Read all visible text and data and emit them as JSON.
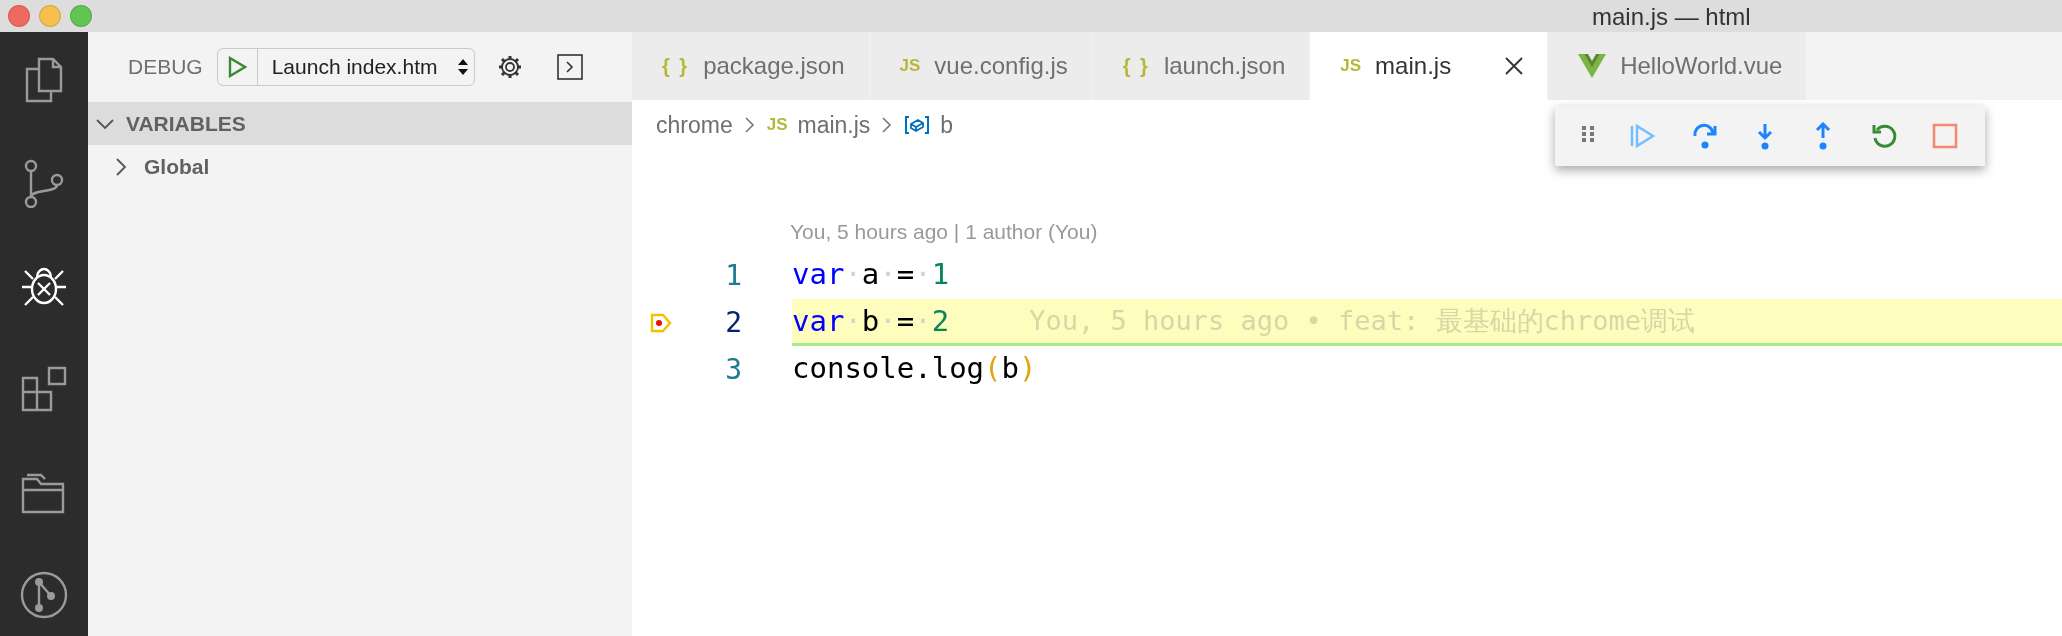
{
  "window": {
    "title": "main.js — html"
  },
  "activity_bar": [
    {
      "kind": "files",
      "selected": false
    },
    {
      "kind": "scm",
      "selected": false
    },
    {
      "kind": "debug",
      "selected": true
    },
    {
      "kind": "extensions",
      "selected": false
    },
    {
      "kind": "folders",
      "selected": false
    },
    {
      "kind": "git",
      "selected": false
    }
  ],
  "sidebar": {
    "debug_label": "DEBUG",
    "launch_config": "Launch index.htm",
    "sections": [
      {
        "title": "VARIABLES",
        "expanded": true,
        "items": [
          {
            "label": "Global",
            "expanded": false
          }
        ]
      }
    ]
  },
  "tabs": [
    {
      "kind": "json",
      "icon_text": "{ }",
      "label": "package.json",
      "selected": false
    },
    {
      "kind": "js",
      "icon_text": "JS",
      "label": "vue.config.js",
      "selected": false
    },
    {
      "kind": "json",
      "icon_text": "{ }",
      "label": "launch.json",
      "selected": false
    },
    {
      "kind": "js",
      "icon_text": "JS",
      "label": "main.js",
      "selected": true
    },
    {
      "kind": "vue",
      "label": "HelloWorld.vue",
      "selected": false
    }
  ],
  "breadcrumbs": [
    {
      "kind": "folder",
      "label": "chrome"
    },
    {
      "kind": "js",
      "icon_text": "JS",
      "label": "main.js"
    },
    {
      "kind": "symbol",
      "label": "b"
    }
  ],
  "editor": {
    "blame_header": "You, 5 hours ago | 1 author (You)",
    "lines": [
      {
        "number": "1",
        "paused": false,
        "tokens": [
          {
            "kind": "keyword",
            "text": "var"
          },
          {
            "kind": "space",
            "text": "·"
          },
          {
            "kind": "plain",
            "text": "a"
          },
          {
            "kind": "space",
            "text": "·"
          },
          {
            "kind": "plain",
            "text": "="
          },
          {
            "kind": "space",
            "text": "·"
          },
          {
            "kind": "number",
            "text": "1"
          }
        ]
      },
      {
        "number": "2",
        "paused": true,
        "blame": "You, 5 hours ago • feat: 最基础的chrome调试",
        "tokens": [
          {
            "kind": "keyword",
            "text": "var"
          },
          {
            "kind": "space",
            "text": "·"
          },
          {
            "kind": "plain",
            "text": "b"
          },
          {
            "kind": "space",
            "text": "·"
          },
          {
            "kind": "plain",
            "text": "="
          },
          {
            "kind": "space",
            "text": "·"
          },
          {
            "kind": "number",
            "text": "2"
          }
        ]
      },
      {
        "number": "3",
        "paused": false,
        "tokens": [
          {
            "kind": "plain",
            "text": "console.log"
          },
          {
            "kind": "paren",
            "text": "("
          },
          {
            "kind": "plain",
            "text": "b"
          },
          {
            "kind": "paren",
            "text": ")"
          }
        ]
      }
    ]
  }
}
